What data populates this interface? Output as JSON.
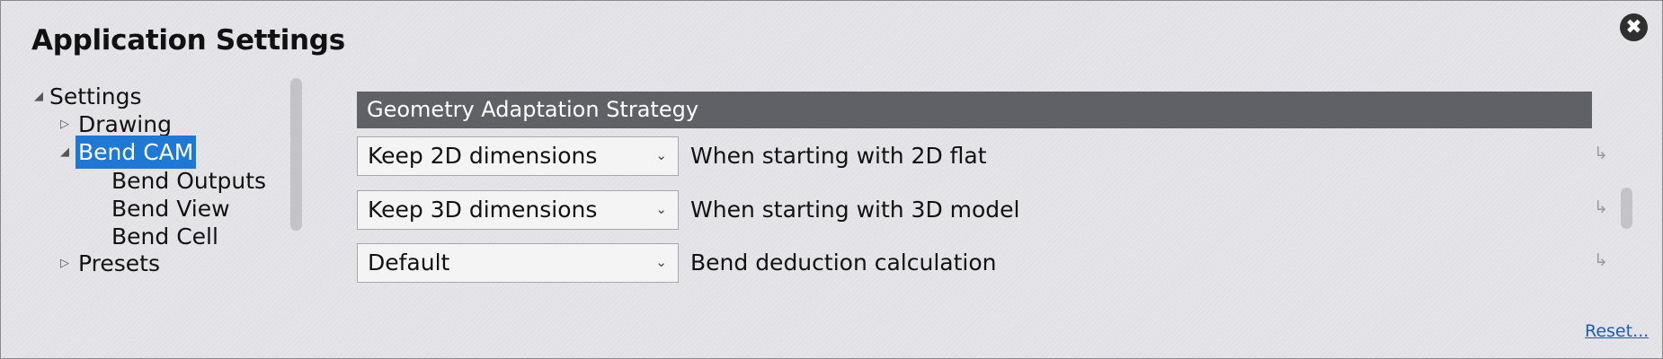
{
  "dialog": {
    "title": "Application Settings",
    "close_glyph": "✖"
  },
  "tree": {
    "items": [
      {
        "label": "Settings",
        "arrow": "◢"
      },
      {
        "label": "Drawing",
        "arrow": "▷"
      },
      {
        "label": "Bend CAM",
        "arrow": "◢"
      },
      {
        "label": "Bend Outputs"
      },
      {
        "label": "Bend View"
      },
      {
        "label": "Bend Cell"
      },
      {
        "label": "Presets",
        "arrow": "▷"
      }
    ],
    "selected": "Bend CAM"
  },
  "section": {
    "title": "Geometry Adaptation Strategy"
  },
  "rows": [
    {
      "value": "Keep 2D dimensions",
      "description": "When starting with 2D flat",
      "icon": "return-arrow-icon"
    },
    {
      "value": "Keep 3D dimensions",
      "description": "When starting with 3D model",
      "icon": "return-arrow-icon"
    },
    {
      "value": "Default",
      "description": "Bend deduction calculation",
      "icon": "return-arrow-icon"
    }
  ],
  "glyphs": {
    "chevron": "⌄",
    "row_icon": "↳"
  },
  "footer": {
    "reset_label": "Reset..."
  },
  "colors": {
    "header_bg": "#606166",
    "selection": "#1e78d6",
    "link": "#1a5fb4"
  }
}
